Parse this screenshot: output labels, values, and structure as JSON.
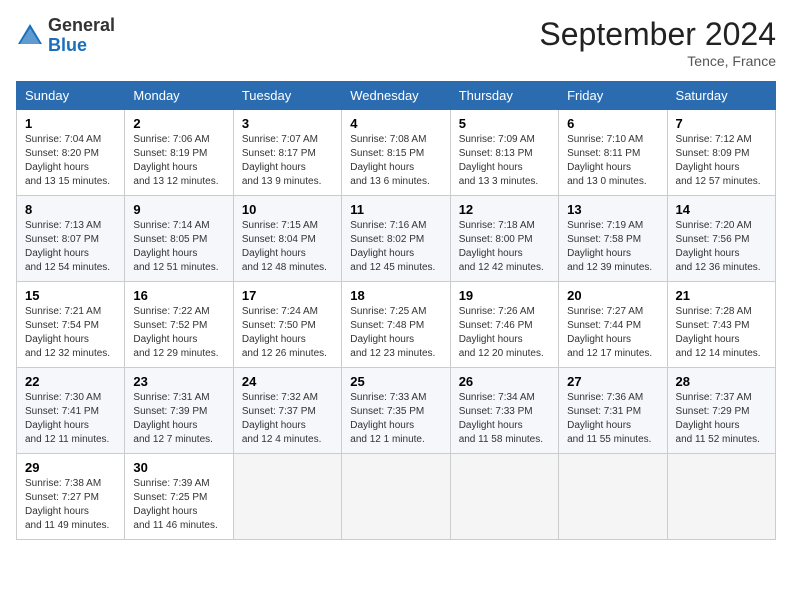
{
  "logo": {
    "general": "General",
    "blue": "Blue"
  },
  "title": "September 2024",
  "location": "Tence, France",
  "weekdays": [
    "Sunday",
    "Monday",
    "Tuesday",
    "Wednesday",
    "Thursday",
    "Friday",
    "Saturday"
  ],
  "weeks": [
    [
      {
        "day": 1,
        "sunrise": "7:04 AM",
        "sunset": "8:20 PM",
        "daylight": "13 hours and 15 minutes."
      },
      {
        "day": 2,
        "sunrise": "7:06 AM",
        "sunset": "8:19 PM",
        "daylight": "13 hours and 12 minutes."
      },
      {
        "day": 3,
        "sunrise": "7:07 AM",
        "sunset": "8:17 PM",
        "daylight": "13 hours and 9 minutes."
      },
      {
        "day": 4,
        "sunrise": "7:08 AM",
        "sunset": "8:15 PM",
        "daylight": "13 hours and 6 minutes."
      },
      {
        "day": 5,
        "sunrise": "7:09 AM",
        "sunset": "8:13 PM",
        "daylight": "13 hours and 3 minutes."
      },
      {
        "day": 6,
        "sunrise": "7:10 AM",
        "sunset": "8:11 PM",
        "daylight": "13 hours and 0 minutes."
      },
      {
        "day": 7,
        "sunrise": "7:12 AM",
        "sunset": "8:09 PM",
        "daylight": "12 hours and 57 minutes."
      }
    ],
    [
      {
        "day": 8,
        "sunrise": "7:13 AM",
        "sunset": "8:07 PM",
        "daylight": "12 hours and 54 minutes."
      },
      {
        "day": 9,
        "sunrise": "7:14 AM",
        "sunset": "8:05 PM",
        "daylight": "12 hours and 51 minutes."
      },
      {
        "day": 10,
        "sunrise": "7:15 AM",
        "sunset": "8:04 PM",
        "daylight": "12 hours and 48 minutes."
      },
      {
        "day": 11,
        "sunrise": "7:16 AM",
        "sunset": "8:02 PM",
        "daylight": "12 hours and 45 minutes."
      },
      {
        "day": 12,
        "sunrise": "7:18 AM",
        "sunset": "8:00 PM",
        "daylight": "12 hours and 42 minutes."
      },
      {
        "day": 13,
        "sunrise": "7:19 AM",
        "sunset": "7:58 PM",
        "daylight": "12 hours and 39 minutes."
      },
      {
        "day": 14,
        "sunrise": "7:20 AM",
        "sunset": "7:56 PM",
        "daylight": "12 hours and 36 minutes."
      }
    ],
    [
      {
        "day": 15,
        "sunrise": "7:21 AM",
        "sunset": "7:54 PM",
        "daylight": "12 hours and 32 minutes."
      },
      {
        "day": 16,
        "sunrise": "7:22 AM",
        "sunset": "7:52 PM",
        "daylight": "12 hours and 29 minutes."
      },
      {
        "day": 17,
        "sunrise": "7:24 AM",
        "sunset": "7:50 PM",
        "daylight": "12 hours and 26 minutes."
      },
      {
        "day": 18,
        "sunrise": "7:25 AM",
        "sunset": "7:48 PM",
        "daylight": "12 hours and 23 minutes."
      },
      {
        "day": 19,
        "sunrise": "7:26 AM",
        "sunset": "7:46 PM",
        "daylight": "12 hours and 20 minutes."
      },
      {
        "day": 20,
        "sunrise": "7:27 AM",
        "sunset": "7:44 PM",
        "daylight": "12 hours and 17 minutes."
      },
      {
        "day": 21,
        "sunrise": "7:28 AM",
        "sunset": "7:43 PM",
        "daylight": "12 hours and 14 minutes."
      }
    ],
    [
      {
        "day": 22,
        "sunrise": "7:30 AM",
        "sunset": "7:41 PM",
        "daylight": "12 hours and 11 minutes."
      },
      {
        "day": 23,
        "sunrise": "7:31 AM",
        "sunset": "7:39 PM",
        "daylight": "12 hours and 7 minutes."
      },
      {
        "day": 24,
        "sunrise": "7:32 AM",
        "sunset": "7:37 PM",
        "daylight": "12 hours and 4 minutes."
      },
      {
        "day": 25,
        "sunrise": "7:33 AM",
        "sunset": "7:35 PM",
        "daylight": "12 hours and 1 minute."
      },
      {
        "day": 26,
        "sunrise": "7:34 AM",
        "sunset": "7:33 PM",
        "daylight": "11 hours and 58 minutes."
      },
      {
        "day": 27,
        "sunrise": "7:36 AM",
        "sunset": "7:31 PM",
        "daylight": "11 hours and 55 minutes."
      },
      {
        "day": 28,
        "sunrise": "7:37 AM",
        "sunset": "7:29 PM",
        "daylight": "11 hours and 52 minutes."
      }
    ],
    [
      {
        "day": 29,
        "sunrise": "7:38 AM",
        "sunset": "7:27 PM",
        "daylight": "11 hours and 49 minutes."
      },
      {
        "day": 30,
        "sunrise": "7:39 AM",
        "sunset": "7:25 PM",
        "daylight": "11 hours and 46 minutes."
      },
      null,
      null,
      null,
      null,
      null
    ]
  ]
}
